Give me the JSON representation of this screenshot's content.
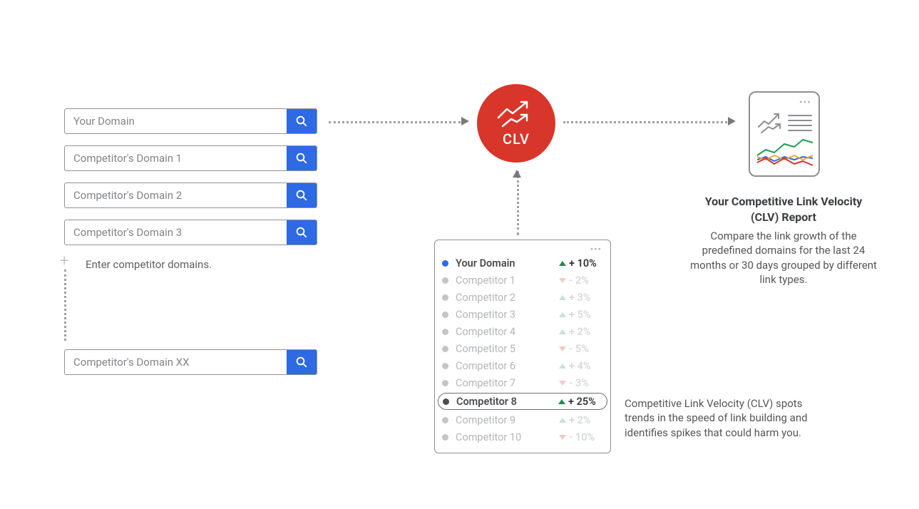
{
  "inputs": {
    "rows": [
      "Your Domain",
      "Competitor's Domain 1",
      "Competitor's Domain 2",
      "Competitor's Domain 3"
    ],
    "last": "Competitor's Domain XX",
    "hint": "Enter competitor domains."
  },
  "clv": {
    "label": "CLV"
  },
  "legend": {
    "rows": [
      {
        "name": "Your Domain",
        "dir": "up",
        "value": "+ 10%",
        "highlight": true,
        "dot": "blue"
      },
      {
        "name": "Competitor 1",
        "dir": "down",
        "value": "-  2%"
      },
      {
        "name": "Competitor 2",
        "dir": "up",
        "value": "+ 3%"
      },
      {
        "name": "Competitor 3",
        "dir": "up",
        "value": "+ 5%"
      },
      {
        "name": "Competitor 4",
        "dir": "up",
        "value": "+ 2%"
      },
      {
        "name": "Competitor 5",
        "dir": "down",
        "value": "-  5%"
      },
      {
        "name": "Competitor 6",
        "dir": "up",
        "value": "+ 4%"
      },
      {
        "name": "Competitor 7",
        "dir": "down",
        "value": "-  3%"
      },
      {
        "name": "Competitor 8",
        "dir": "up",
        "value": "+ 25%",
        "highlight": true,
        "boxed": true,
        "dot": "dark"
      },
      {
        "name": "Competitor 9",
        "dir": "up",
        "value": "+ 2%"
      },
      {
        "name": "Competitor 10",
        "dir": "down",
        "value": "- 10%"
      }
    ]
  },
  "report": {
    "title": "Your Competitive Link Velocity (CLV) Report",
    "desc": "Compare the link growth of the predefined domains for the last 24 months or 30 days grouped by different link types."
  },
  "note": "Competitive Link Velocity (CLV) spots trends in the speed of link building and identifies spikes that could harm you."
}
